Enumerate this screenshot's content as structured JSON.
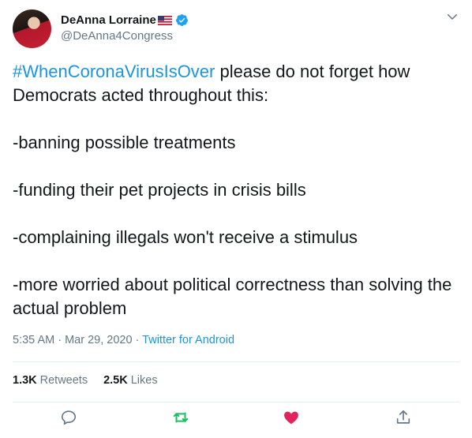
{
  "author": {
    "display_name": "DeAnna Lorraine",
    "handle": "@DeAnna4Congress"
  },
  "tweet": {
    "hashtag": "#WhenCoronaVirusIsOver",
    "text_after_hashtag": " please do not forget how Democrats acted throughout this:\n\n-banning possible treatments\n\n-funding their pet projects in crisis bills\n\n-complaining illegals won't receive a stimulus\n\n-more worried about political correctness than solving the actual problem"
  },
  "meta": {
    "time": "5:35 AM",
    "separator1": " · ",
    "date": "Mar 29, 2020",
    "separator2": " · ",
    "source": "Twitter for Android"
  },
  "stats": {
    "retweets_count": "1.3K",
    "retweets_label": "Retweets",
    "likes_count": "2.5K",
    "likes_label": "Likes"
  },
  "colors": {
    "accent": "#1b95e0",
    "retweet": "#17bf63",
    "like": "#e0245e",
    "muted": "#657786"
  },
  "icons": [
    "verified-badge-icon",
    "us-flag-icon",
    "chevron-down-icon",
    "reply-icon",
    "retweet-icon",
    "like-icon",
    "share-icon"
  ]
}
